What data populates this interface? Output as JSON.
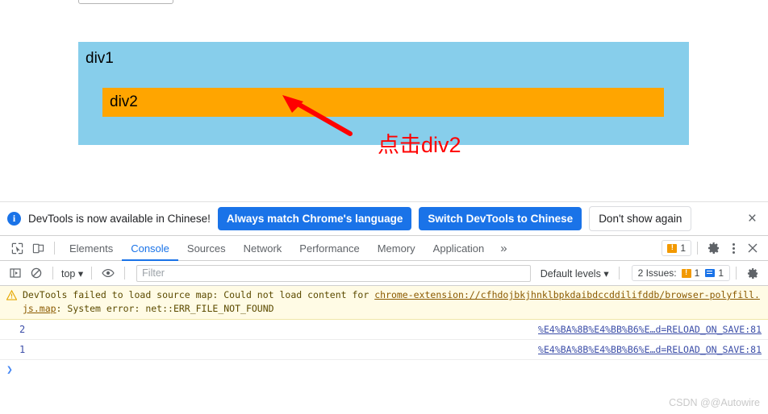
{
  "page": {
    "div1_label": "div1",
    "div2_label": "div2",
    "annotation": "点击div2",
    "div1_color": "#87CEEB",
    "div2_color": "#FFA500",
    "annotation_color": "#FF0000"
  },
  "notification": {
    "info_icon": "info-icon",
    "message": "DevTools is now available in Chinese!",
    "primary_button": "Always match Chrome's language",
    "secondary_button": "Switch DevTools to Chinese",
    "dismiss_button": "Don't show again",
    "close_icon": "×",
    "accent_color": "#1a73e8"
  },
  "toolbar": {
    "inspect_icon": "inspect-element-icon",
    "device_icon": "device-toolbar-icon",
    "tabs": [
      {
        "label": "Elements",
        "active": false
      },
      {
        "label": "Console",
        "active": true
      },
      {
        "label": "Sources",
        "active": false
      },
      {
        "label": "Network",
        "active": false
      },
      {
        "label": "Performance",
        "active": false
      },
      {
        "label": "Memory",
        "active": false
      },
      {
        "label": "Application",
        "active": false
      }
    ],
    "overflow_label": "»",
    "warning_count": "1",
    "settings_icon": "gear-icon",
    "more_icon": "kebab-menu-icon",
    "close_icon": "×",
    "active_tab_color": "#1a73e8"
  },
  "console_toolbar": {
    "sidebar_icon": "console-sidebar-icon",
    "clear_icon": "clear-console-icon",
    "context": "top",
    "context_caret": "▾",
    "eye_icon": "live-expression-eye-icon",
    "filter_placeholder": "Filter",
    "filter_value": "",
    "levels_label": "Default levels",
    "levels_caret": "▾",
    "issues_label": "2 Issues:",
    "issues_warning_count": "1",
    "issues_info_count": "1",
    "settings_icon": "gear-icon"
  },
  "console_messages": {
    "warning": {
      "icon": "warning-triangle-icon",
      "text_before": "DevTools failed to load source map: Could not load content for ",
      "link": "chrome-extension://cfhdojbkjhnklbpkdaibdccddilifddb/browser-polyfill.js.map",
      "text_after": ": System error: net::ERR_FILE_NOT_FOUND"
    },
    "logs": [
      {
        "value": "2",
        "source": "%E4%BA%8B%E4%BB%B6%E…d=RELOAD_ON_SAVE:81"
      },
      {
        "value": "1",
        "source": "%E4%BA%8B%E4%BB%B6%E…d=RELOAD_ON_SAVE:81"
      }
    ],
    "prompt_chevron": "❯"
  },
  "watermark": {
    "text": "CSDN @@Autowire"
  }
}
